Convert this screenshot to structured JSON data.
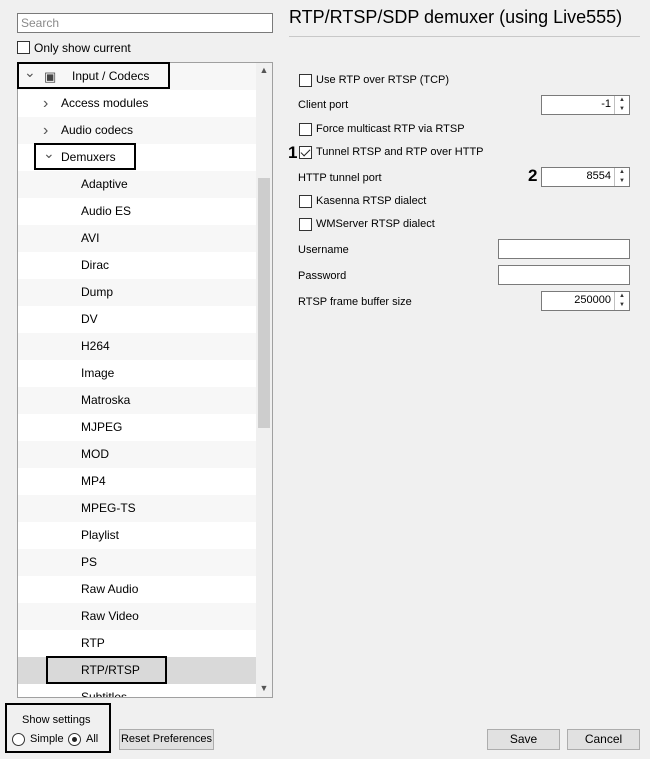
{
  "search": {
    "placeholder": "Search"
  },
  "only_show_current": {
    "label": "Only show current",
    "checked": false
  },
  "tree": {
    "items": [
      {
        "label": "Input / Codecs",
        "expanded": true,
        "level": 0
      },
      {
        "label": "Access modules",
        "expanded": false,
        "level": 1
      },
      {
        "label": "Audio codecs",
        "expanded": false,
        "level": 1
      },
      {
        "label": "Demuxers",
        "expanded": true,
        "level": 1
      },
      {
        "label": "Adaptive",
        "level": 2
      },
      {
        "label": "Audio ES",
        "level": 2
      },
      {
        "label": "AVI",
        "level": 2
      },
      {
        "label": "Dirac",
        "level": 2
      },
      {
        "label": "Dump",
        "level": 2
      },
      {
        "label": "DV",
        "level": 2
      },
      {
        "label": "H264",
        "level": 2
      },
      {
        "label": "Image",
        "level": 2
      },
      {
        "label": "Matroska",
        "level": 2
      },
      {
        "label": "MJPEG",
        "level": 2
      },
      {
        "label": "MOD",
        "level": 2
      },
      {
        "label": "MP4",
        "level": 2
      },
      {
        "label": "MPEG-TS",
        "level": 2
      },
      {
        "label": "Playlist",
        "level": 2
      },
      {
        "label": "PS",
        "level": 2
      },
      {
        "label": "Raw Audio",
        "level": 2
      },
      {
        "label": "Raw Video",
        "level": 2
      },
      {
        "label": "RTP",
        "level": 2
      },
      {
        "label": "RTP/RTSP",
        "level": 2,
        "selected": true
      },
      {
        "label": "Subtitles",
        "level": 2
      }
    ]
  },
  "panel": {
    "title": "RTP/RTSP/SDP demuxer (using Live555)",
    "use_rtp_over_rtsp": {
      "label": "Use RTP over RTSP (TCP)",
      "checked": false
    },
    "client_port": {
      "label": "Client port",
      "value": "-1"
    },
    "force_multicast": {
      "label": "Force multicast RTP via RTSP",
      "checked": false
    },
    "tunnel_http": {
      "label": "Tunnel RTSP and RTP over HTTP",
      "checked": true
    },
    "http_tunnel_port": {
      "label": "HTTP tunnel port",
      "value": "8554"
    },
    "kasenna": {
      "label": "Kasenna RTSP dialect",
      "checked": false
    },
    "wmserver": {
      "label": "WMServer RTSP dialect",
      "checked": false
    },
    "username": {
      "label": "Username",
      "value": ""
    },
    "password": {
      "label": "Password",
      "value": ""
    },
    "frame_buffer": {
      "label": "RTSP frame buffer size",
      "value": "250000"
    }
  },
  "markers": {
    "one": "1",
    "two": "2"
  },
  "show_settings": {
    "label": "Show settings",
    "simple_label": "Simple",
    "all_label": "All",
    "selected": "All"
  },
  "buttons": {
    "reset": "Reset Preferences",
    "save": "Save",
    "cancel": "Cancel"
  }
}
